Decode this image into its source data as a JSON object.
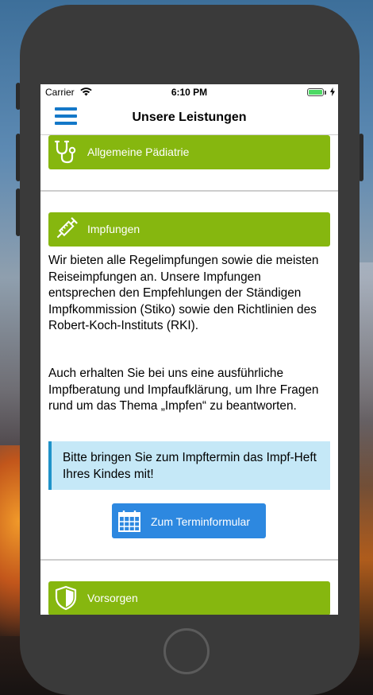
{
  "status_bar": {
    "carrier": "Carrier",
    "time": "6:10 PM",
    "battery_level": 1.0
  },
  "nav": {
    "title": "Unsere Leistungen",
    "menu_icon": "hamburger-menu-icon"
  },
  "sections": [
    {
      "title": "Allgemeine Pädiatrie",
      "icon": "stethoscope-icon"
    },
    {
      "title": "Impfungen",
      "icon": "syringe-icon"
    },
    {
      "title": "Vorsorgen",
      "icon": "shield-icon"
    }
  ],
  "impfungen": {
    "paragraph1": "Wir bieten alle Regelimpfungen sowie die meisten Reiseimpfungen an. Unsere Impfungen entsprechen den Empfehlungen der Ständigen Impfkommission (Stiko) sowie den Richtlinien des Robert-Koch-Instituts (RKI).",
    "paragraph2": "Auch erhalten Sie bei uns eine ausführliche Impfberatung und Impfaufklärung, um Ihre Fragen rund um das Thema „Impfen“ zu beantworten.",
    "callout": "Bitte bringen Sie zum Impftermin das Impf-Heft Ihres Kindes mit!",
    "button_label": "Zum Terminformular",
    "button_icon": "calendar-icon"
  },
  "colors": {
    "section_header": "#86b70f",
    "nav_accent": "#1478c8",
    "button": "#2d88e0",
    "callout_bg": "#c5e8f7",
    "callout_border": "#1f93c9"
  }
}
